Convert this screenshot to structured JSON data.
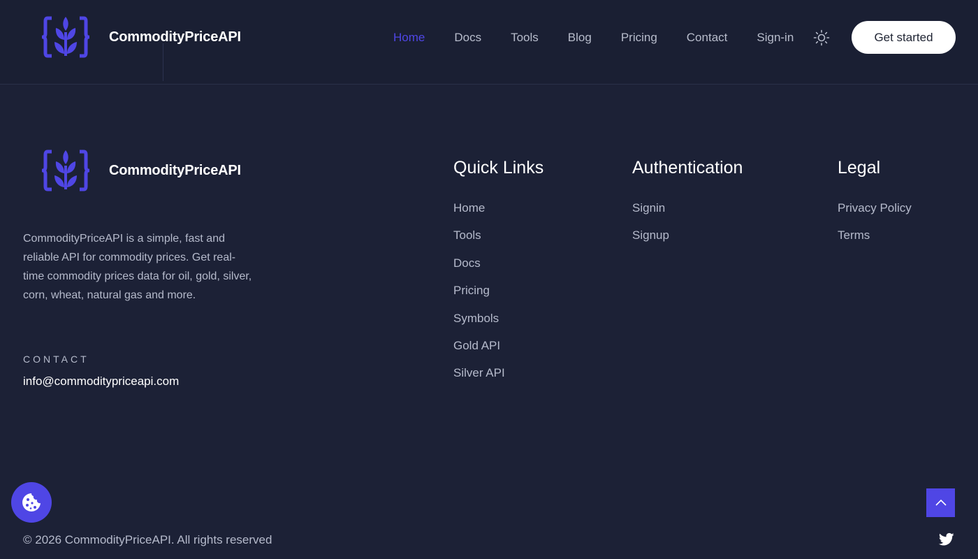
{
  "brand": {
    "name": "CommodityPriceAPI",
    "accent": "#4f46e5"
  },
  "header": {
    "nav": [
      {
        "label": "Home",
        "active": true
      },
      {
        "label": "Docs"
      },
      {
        "label": "Tools"
      },
      {
        "label": "Blog"
      },
      {
        "label": "Pricing"
      },
      {
        "label": "Contact"
      },
      {
        "label": "Sign-in"
      }
    ],
    "theme_icon": "sun-icon",
    "cta_label": "Get started"
  },
  "footer": {
    "description": "CommodityPriceAPI is a simple, fast and reliable API for commodity prices. Get real-time commodity prices data for oil, gold, silver, corn, wheat, natural gas and more.",
    "contact_label": "CONTACT",
    "contact_email": "info@commoditypriceapi.com",
    "columns": [
      {
        "title": "Quick Links",
        "links": [
          "Home",
          "Tools",
          "Docs",
          "Pricing",
          "Symbols",
          "Gold API",
          "Silver API"
        ]
      },
      {
        "title": "Authentication",
        "links": [
          "Signin",
          "Signup"
        ]
      },
      {
        "title": "Legal",
        "links": [
          "Privacy Policy",
          "Terms"
        ]
      }
    ],
    "copyright": "© 2026 CommodityPriceAPI. All rights reserved"
  },
  "widgets": {
    "cookie_icon": "cookie-icon",
    "scroll_top_icon": "chevron-up-icon",
    "social_icon": "twitter-icon"
  }
}
